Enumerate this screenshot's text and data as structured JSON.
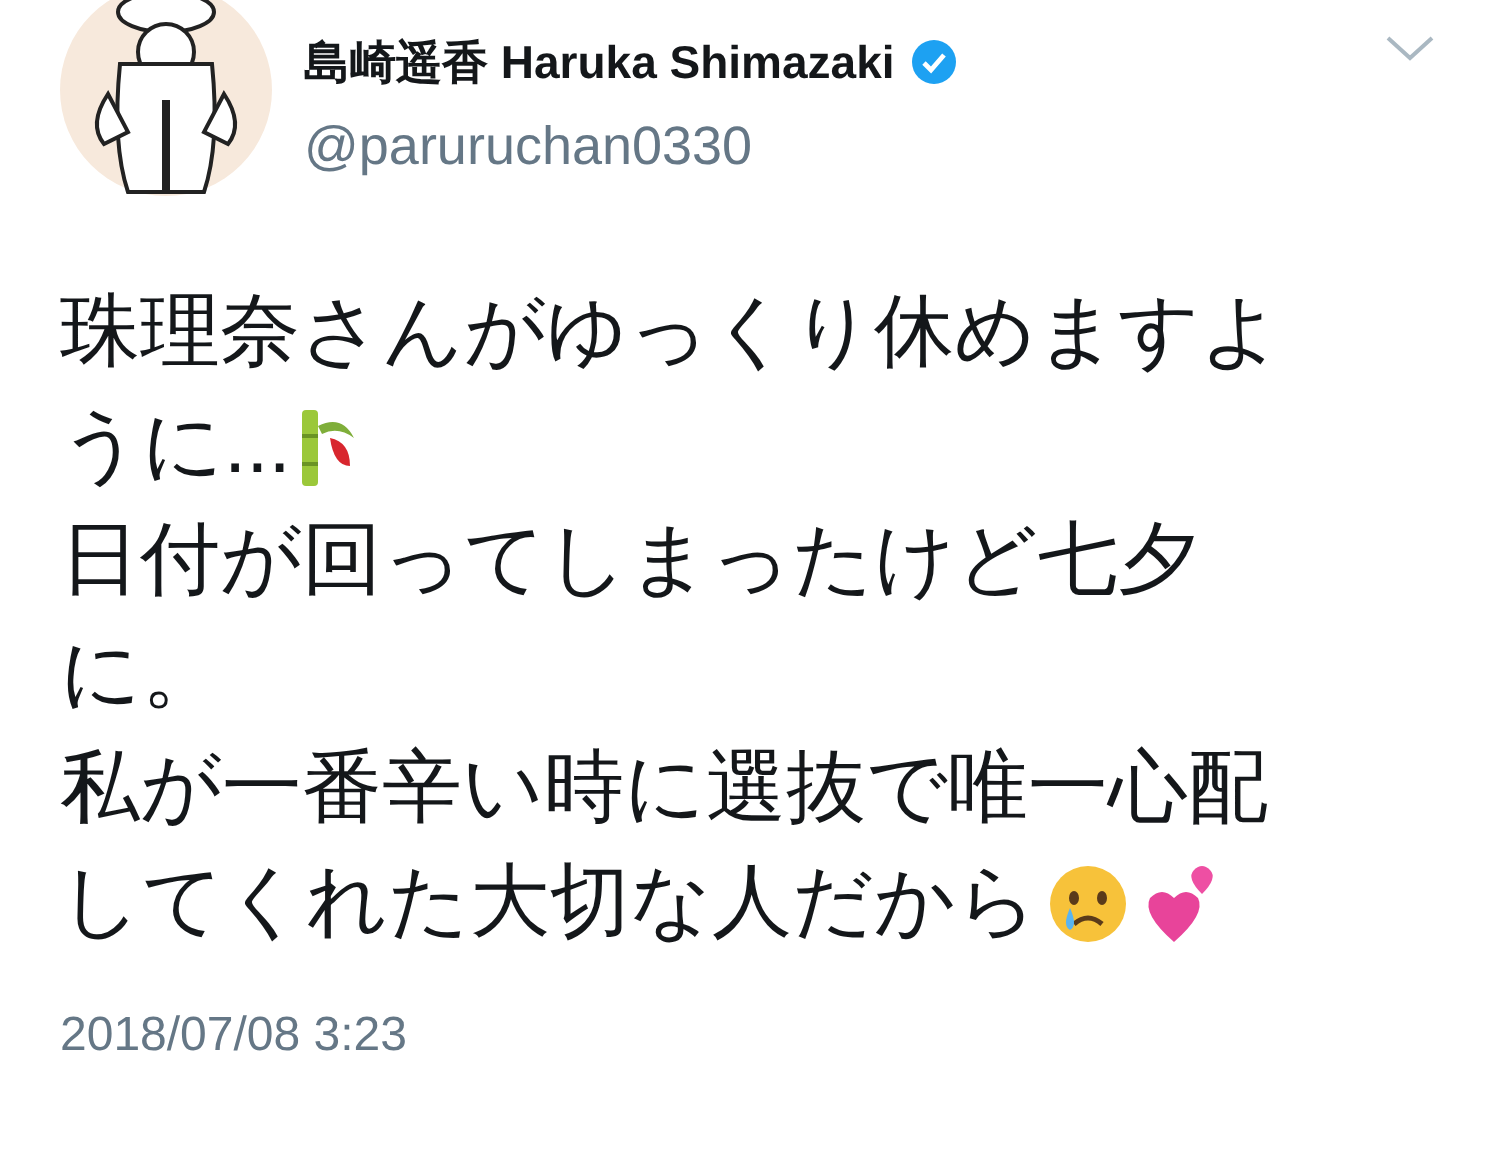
{
  "author": {
    "name": "島崎遥香 Haruka Shimazaki",
    "verified": true,
    "handle": "@paruruchan0330"
  },
  "body_lines": [
    "珠理奈さんがゆっくり休めますよ",
    "うに...",
    "日付が回ってしまったけど七夕",
    "に。",
    "私が一番辛い時に選抜で唯一心配",
    "してくれた大切な人だから"
  ],
  "timestamp": "2018/07/08 3:23"
}
